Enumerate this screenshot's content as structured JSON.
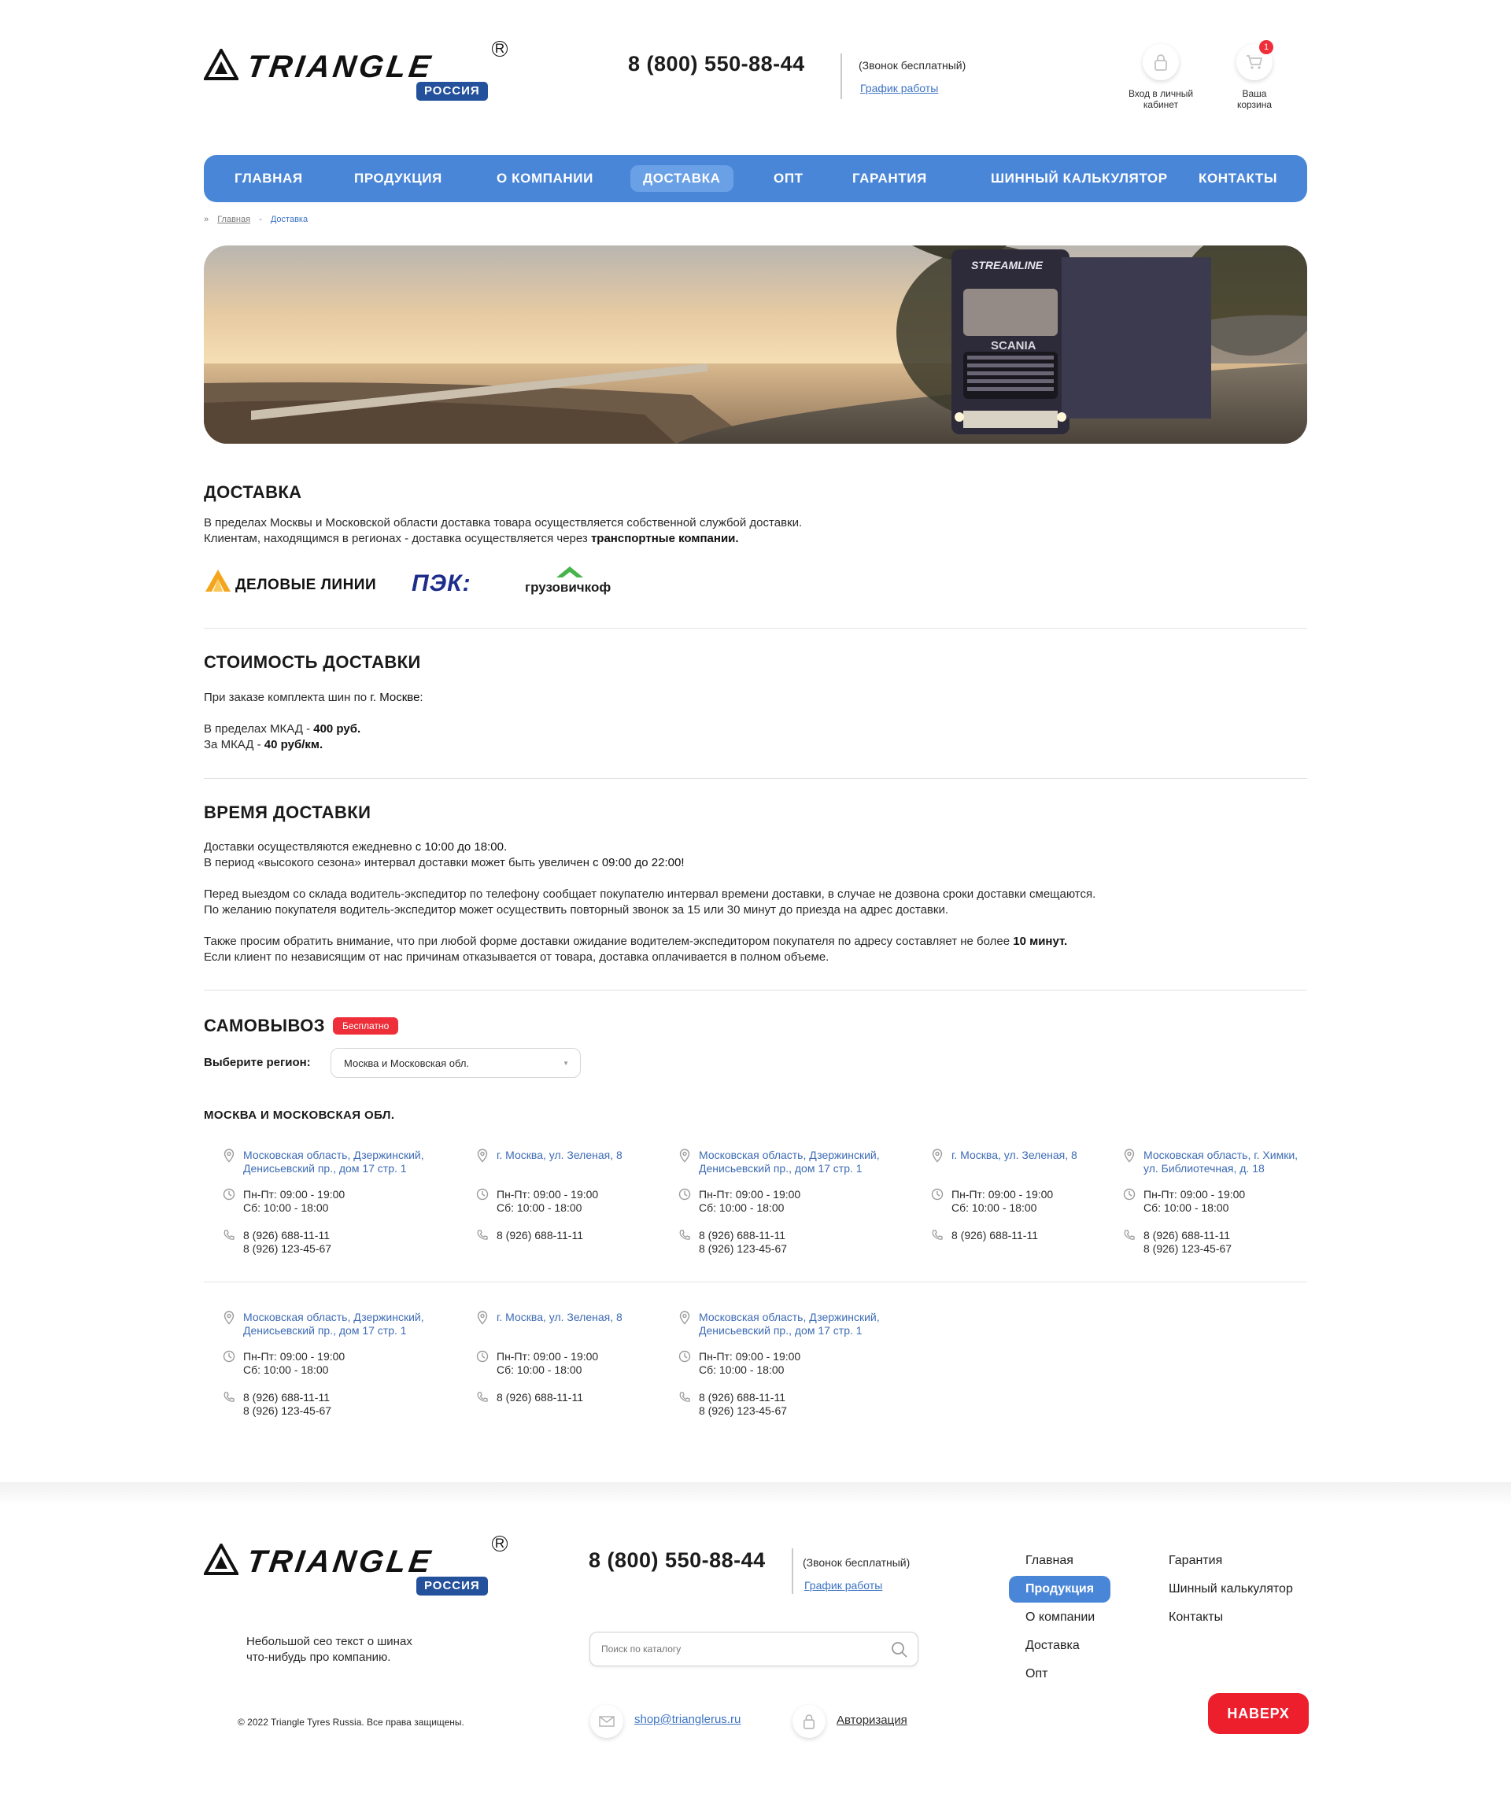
{
  "header": {
    "logo_word": "TRIANGLE",
    "logo_reg": "R",
    "logo_badge": "РОССИЯ",
    "phone": "8 (800) 550-88-44",
    "free_call": "(Звонок бесплатный)",
    "schedule_link": "График работы",
    "account_label": "Вход в личный кабинет",
    "cart_label": "Ваша корзина",
    "cart_count": "1"
  },
  "nav": [
    {
      "label": "ГЛАВНАЯ",
      "active": false
    },
    {
      "label": "ПРОДУКЦИЯ",
      "active": false
    },
    {
      "label": "О КОМПАНИИ",
      "active": false
    },
    {
      "label": "ДОСТАВКА",
      "active": true
    },
    {
      "label": "ОПТ",
      "active": false
    },
    {
      "label": "ГАРАНТИЯ",
      "active": false
    },
    {
      "label": "ШИННЫЙ КАЛЬКУЛЯТОР",
      "active": false
    },
    {
      "label": "КОНТАКТЫ",
      "active": false
    }
  ],
  "breadcrumb": {
    "sep": "»",
    "home": "Главная",
    "dash": "-",
    "current": "Доставка"
  },
  "hero": {
    "truck_top_text": "STREAMLINE",
    "truck_grille_text": "SCANIA"
  },
  "delivery": {
    "title": "ДОСТАВКА",
    "line1": "В пределах Москвы и Московской области доставка товара осуществляется собственной службой доставки.",
    "line2_prefix": "Клиентам, находящимся в регионах - доставка осуществляется через ",
    "line2_bold": "транспортные компании.",
    "carriers": [
      "ДЕЛОВЫЕ ЛИНИИ",
      "ПЭК:",
      "грузовичкоф"
    ]
  },
  "cost": {
    "title": "СТОИМОСТЬ ДОСТАВКИ",
    "intro_prefix": "При заказе комплекта шин по ",
    "intro_city": "г. Москве:",
    "line1_prefix": "В пределах МКАД - ",
    "line1_value": "400 руб.",
    "line2_prefix": "За МКАД - ",
    "line2_value": "40 руб/км."
  },
  "time": {
    "title": "ВРЕМЯ ДОСТАВКИ",
    "p1_prefix": "Доставки осуществляются ежедневно ",
    "p1_value": "с 10:00 до 18:00.",
    "p2_prefix": "В период «высокого сезона» интервал доставки может быть увеличен ",
    "p2_value": "с 09:00 до 22:00!",
    "p3": "Перед выездом со склада водитель-экспедитор по телефону сообщает покупателю интервал времени доставки, в случае не дозвона сроки доставки смещаются.",
    "p4": "По желанию покупателя водитель-экспедитор может осуществить повторный звонок за 15 или 30 минут до приезда на адрес доставки.",
    "p5_prefix": "Также просим обратить внимание, что при любой форме доставки ожидание водителем-экспедитором покупателя по адресу составляет не более ",
    "p5_value": "10 минут.",
    "p6": "Если клиент по независящим от нас причинам отказывается от товара, доставка оплачивается в полном объеме."
  },
  "pickup": {
    "title": "САМОВЫВОЗ",
    "badge": "Бесплатно",
    "region_label": "Выберите регион:",
    "region_selected": "Москва и Московская обл.",
    "caret": "▼",
    "region_title": "МОСКВА И МОСКОВСКАЯ ОБЛ.",
    "points": [
      {
        "addr1": "Московская область, Дзержинский,",
        "addr2": "Денисьевский пр., дом 17 стр. 1",
        "hrs1": "Пн-Пт: 09:00 - 19:00",
        "hrs2": "Сб: 10:00 - 18:00",
        "tel1": "8 (926) 688-11-11",
        "tel2": "8 (926) 123-45-67"
      },
      {
        "addr1": "г. Москва, ул. Зеленая, 8",
        "addr2": "",
        "hrs1": "Пн-Пт: 09:00 - 19:00",
        "hrs2": "Сб: 10:00 - 18:00",
        "tel1": "8 (926) 688-11-11",
        "tel2": ""
      },
      {
        "addr1": "Московская область, Дзержинский,",
        "addr2": "Денисьевский пр., дом 17 стр. 1",
        "hrs1": "Пн-Пт: 09:00 - 19:00",
        "hrs2": "Сб: 10:00 - 18:00",
        "tel1": "8 (926) 688-11-11",
        "tel2": "8 (926) 123-45-67"
      },
      {
        "addr1": "г. Москва, ул. Зеленая, 8",
        "addr2": "",
        "hrs1": "Пн-Пт: 09:00 - 19:00",
        "hrs2": "Сб: 10:00 - 18:00",
        "tel1": "8 (926) 688-11-11",
        "tel2": ""
      },
      {
        "addr1": "Московская область, г. Химки,",
        "addr2": "ул. Библиотечная, д. 18",
        "hrs1": "Пн-Пт: 09:00 - 19:00",
        "hrs2": "Сб: 10:00 - 18:00",
        "tel1": "8 (926) 688-11-11",
        "tel2": "8 (926) 123-45-67"
      },
      {
        "addr1": "Московская область, Дзержинский,",
        "addr2": "Денисьевский пр., дом 17 стр. 1",
        "hrs1": "Пн-Пт: 09:00 - 19:00",
        "hrs2": "Сб: 10:00 - 18:00",
        "tel1": "8 (926) 688-11-11",
        "tel2": "8 (926) 123-45-67"
      },
      {
        "addr1": "г. Москва, ул. Зеленая, 8",
        "addr2": "",
        "hrs1": "Пн-Пт: 09:00 - 19:00",
        "hrs2": "Сб: 10:00 - 18:00",
        "tel1": "8 (926) 688-11-11",
        "tel2": ""
      },
      {
        "addr1": "Московская область, Дзержинский,",
        "addr2": "Денисьевский пр., дом 17 стр. 1",
        "hrs1": "Пн-Пт: 09:00 - 19:00",
        "hrs2": "Сб: 10:00 - 18:00",
        "tel1": "8 (926) 688-11-11",
        "tel2": "8 (926) 123-45-67"
      }
    ]
  },
  "footer": {
    "phone": "8 (800) 550-88-44",
    "free_call": "(Звонок бесплатный)",
    "schedule_link": "График работы",
    "seo_line1": "Небольшой сео текст о шинах",
    "seo_line2": "что-нибудь про компанию.",
    "copyright": "© 2022 Triangle Tyres Russia. Все права защищены.",
    "search_placeholder": "Поиск по каталогу",
    "email": "shop@trianglerus.ru",
    "auth": "Авторизация",
    "nav": [
      {
        "label": "Главная",
        "active": false
      },
      {
        "label": "Продукция",
        "active": true
      },
      {
        "label": "О компании",
        "active": false
      },
      {
        "label": "Доставка",
        "active": false
      },
      {
        "label": "Опт",
        "active": false
      },
      {
        "label": "Гарантия",
        "active": false
      },
      {
        "label": "Шинный калькулятор",
        "active": false
      },
      {
        "label": "Контакты",
        "active": false
      }
    ],
    "top_button": "НАВЕРХ"
  },
  "colors": {
    "nav_blue": "#4a86d8",
    "link_blue": "#3d73c4",
    "accent_red": "#ee2f3a",
    "badge_navy": "#24519b"
  }
}
